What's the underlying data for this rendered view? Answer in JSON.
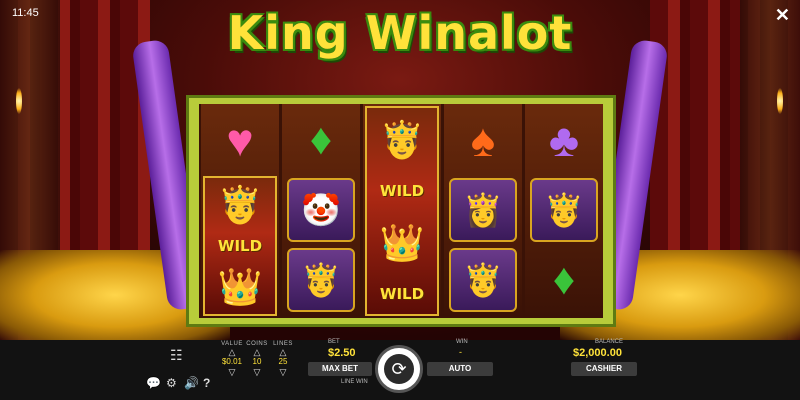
{
  "status": {
    "time": "11:45"
  },
  "game": {
    "title": "King Winalot"
  },
  "reels": [
    [
      "heart",
      "wild-king-top",
      "wild-king-bottom"
    ],
    [
      "diamond",
      "jester",
      "king-face"
    ],
    [
      "wild-king-top",
      "wild-king-mid",
      "wild-king-bottom"
    ],
    [
      "spade",
      "queen",
      "king-face"
    ],
    [
      "club",
      "king-face",
      "diamond"
    ]
  ],
  "symbols": {
    "wild_label": "WILD",
    "heart_glyph": "♥",
    "diamond_glyph": "♦",
    "spade_glyph": "♠",
    "club_glyph": "♣",
    "king_glyph": "🤴",
    "jester_glyph": "🤡",
    "queen_glyph": "👸"
  },
  "controls": {
    "value_label": "VALUE",
    "value": "$0.01",
    "coins_label": "COINS",
    "coins": "10",
    "lines_label": "LINES",
    "lines": "25",
    "up_arrow": "△",
    "down_arrow": "▽",
    "bet_label": "BET",
    "bet": "$2.50",
    "max_bet": "MAX BET",
    "line_win_label": "LINE WIN",
    "win_label": "WIN",
    "win": "-",
    "auto": "AUTO",
    "balance_label": "BALANCE",
    "balance": "$2,000.00",
    "cashier": "CASHIER",
    "spin_glyph": "⟳",
    "close_glyph": "✕",
    "paytable_glyph": "☷",
    "chat_glyph": "💬",
    "settings_glyph": "⚙",
    "sound_glyph": "🔊",
    "help_glyph": "?"
  },
  "colors": {
    "accent": "#ffe33a",
    "frame": "#b8cc3a",
    "ribbon": "#9b4fd6"
  }
}
